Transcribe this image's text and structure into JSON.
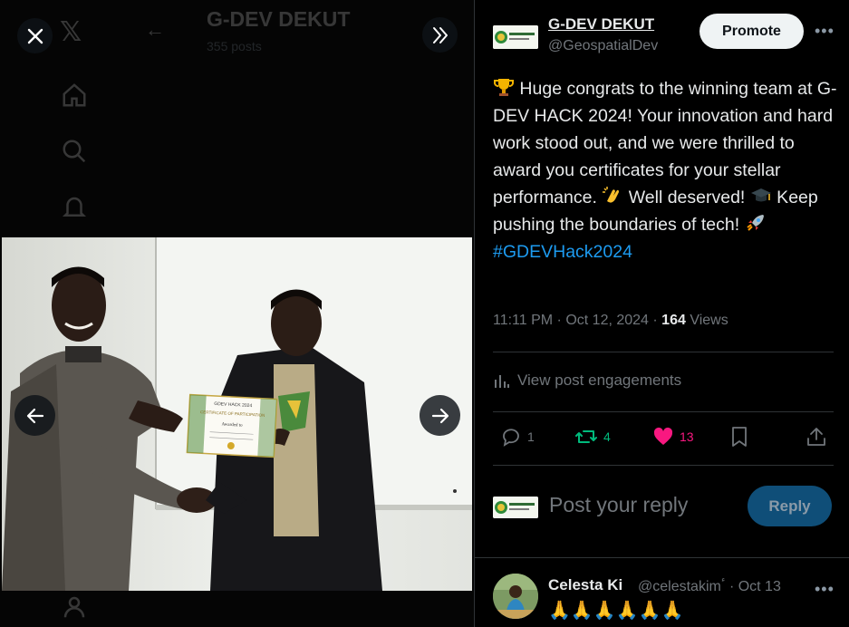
{
  "background": {
    "title": "G-DEV DEKUT",
    "subtitle": "355 posts"
  },
  "viewer": {
    "close_icon": "close-icon",
    "expand_icon": "double-chevron-right-icon",
    "prev_icon": "arrow-left-icon",
    "next_icon": "arrow-right-icon",
    "certificate_header": "GDEV HACK 2024",
    "certificate_title": "CERTIFICATE OF PARTICIPATION",
    "certificate_name": "Awarded to"
  },
  "post": {
    "author_name": "G-DEV DEKUT",
    "author_handle": "@GeospatialDev",
    "promote_label": "Promote",
    "text_part1": " Huge congrats to the winning team at G-DEV HACK 2024! Your innovation and hard work stood out, and we were thrilled to award you certificates for your stellar performance. ",
    "text_part2": " Well deserved! ",
    "text_part3": " Keep pushing the boundaries of tech! ",
    "hashtag": "#GDEVHack2024",
    "timestamp": "11:11 PM · Oct 12, 2024 · ",
    "views_count": "164",
    "views_label": " Views",
    "engagements_label": "View post engagements",
    "replies_count": "1",
    "reposts_count": "4",
    "likes_count": "13",
    "reply_placeholder": "Post your reply",
    "reply_button": "Reply"
  },
  "reply": {
    "name": "Celesta Ki",
    "handle": "@celestakimٴ · Oct 13",
    "text": "🙏🙏🙏🙏🙏🙏"
  },
  "colors": {
    "accent": "#1d9bf0",
    "repost": "#00ba7c",
    "like": "#f91880"
  }
}
